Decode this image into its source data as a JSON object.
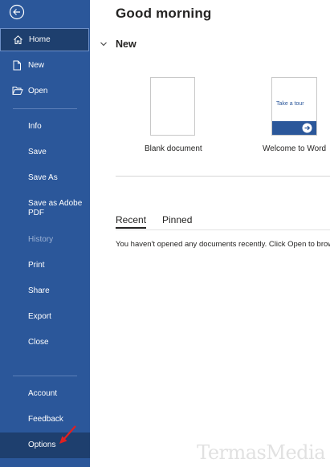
{
  "colors": {
    "sidebar_bg": "#2b579a",
    "active_bg": "#1e3f6e",
    "annotation": "#e02020"
  },
  "sidebar": {
    "back": "back-arrow-icon",
    "items": [
      {
        "label": "Home",
        "icon": "home-icon"
      },
      {
        "label": "New",
        "icon": "new-doc-icon"
      },
      {
        "label": "Open",
        "icon": "folder-open-icon"
      },
      {
        "label": "Info"
      },
      {
        "label": "Save"
      },
      {
        "label": "Save As"
      },
      {
        "label": "Save as Adobe PDF"
      },
      {
        "label": "History"
      },
      {
        "label": "Print"
      },
      {
        "label": "Share"
      },
      {
        "label": "Export"
      },
      {
        "label": "Close"
      },
      {
        "label": "Account"
      },
      {
        "label": "Feedback"
      },
      {
        "label": "Options"
      }
    ]
  },
  "main": {
    "greeting": "Good morning",
    "new_section": "New",
    "templates": [
      {
        "label": "Blank document"
      },
      {
        "label": "Welcome to Word",
        "banner": "Take a tour"
      }
    ],
    "tabs": [
      {
        "label": "Recent"
      },
      {
        "label": "Pinned"
      }
    ],
    "empty_message": "You haven't opened any documents recently. Click Open to brow"
  },
  "watermark": "TermasMedia"
}
